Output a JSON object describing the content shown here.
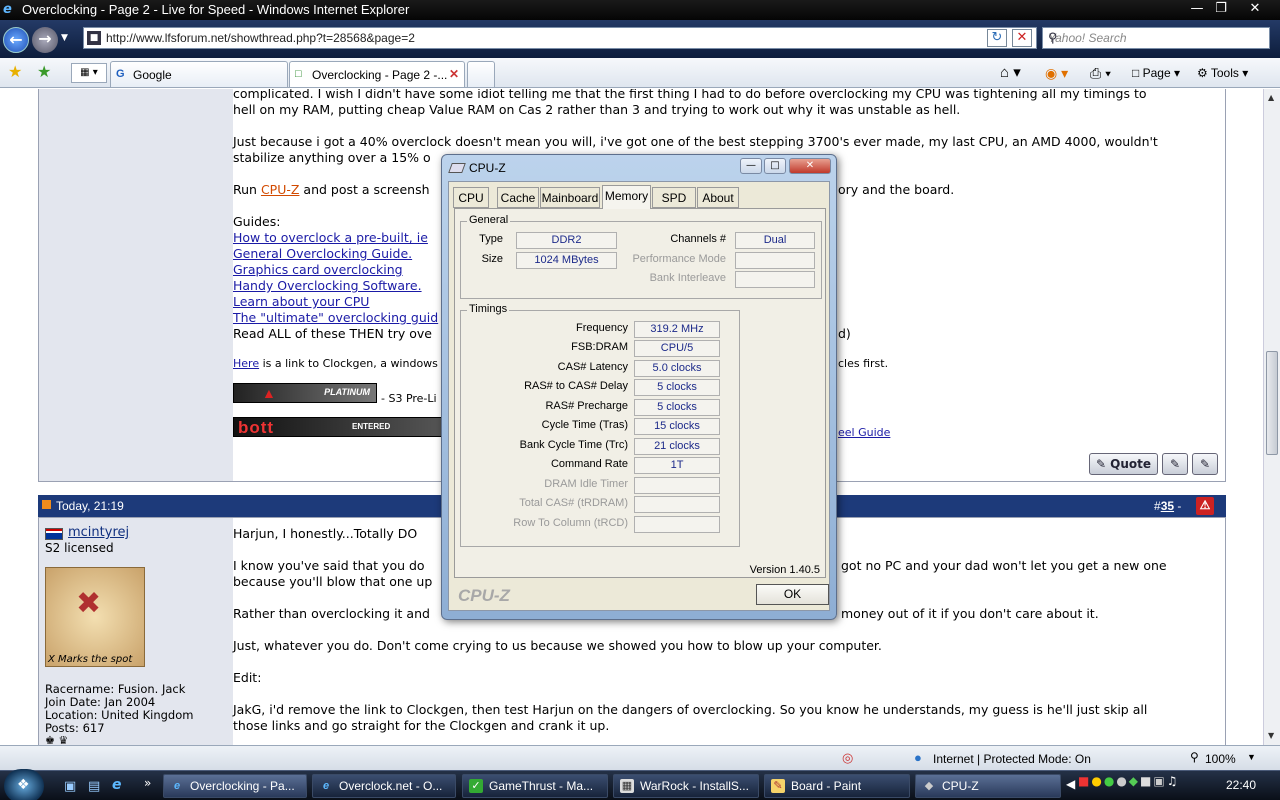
{
  "window": {
    "title": "Overclocking - Page 2 - Live for Speed - Windows Internet Explorer"
  },
  "toolbar": {
    "address": "http://www.lfsforum.net/showthread.php?t=28568&page=2",
    "search_placeholder": "Yahoo! Search"
  },
  "tabs": [
    {
      "label": "Google"
    },
    {
      "label": "Overclocking - Page 2 -..."
    }
  ],
  "commandbar": {
    "page": "Page",
    "tools": "Tools"
  },
  "post1": {
    "line1": "complicated. I wish I didn't have some idiot telling me that the first thing I had to do before overclocking my CPU was tightening all my timings to",
    "line2": "hell on my RAM, putting cheap Value RAM on Cas 2 rather than 3 and trying to work out why it was unstable as hell.",
    "line3": "Just because i got a 40% overclock doesn't mean you will, i've got one of the best stepping 3700's ever made, my last CPU, an AMD 4000, wouldn't",
    "line4a": "stabilize anything over a 15% o",
    "run_pre": "Run ",
    "run_link": "CPU-Z",
    "run_post": " and post a screensh",
    "run_tail": "ory and the board.",
    "guides": "Guides:",
    "links": [
      "How to overclock a pre-built, ie",
      "General Overclocking Guide.",
      "Graphics card overclocking",
      "Handy Overclocking Software.",
      "Learn about your CPU",
      "The \"ultimate\" overclocking guid"
    ],
    "readall": "Read ALL of these THEN try ove",
    "readall_tail": "d)",
    "here_link": "Here",
    "here_text": " is a link to Clockgen, a windows",
    "here_tail": "cles first.",
    "sig1": "- S3 Pre-Li",
    "sig_link_tail": "eel Guide",
    "quote_btn": "Quote"
  },
  "post2": {
    "date": "Today, 21:19",
    "number_prefix": "#",
    "number": "35",
    "number_sep": "-",
    "username": "mcintyrej",
    "license": "S2 licensed",
    "avatar_caption": "X Marks the spot",
    "racername": "Racername: Fusion. Jack",
    "joindate": "Join Date: Jan 2004",
    "location": "Location: United Kingdom",
    "posts": "Posts: 617",
    "l1": "Harjun, I honestly...Totally DO",
    "l2a": "I know you've said that you do",
    "l2b": "got no PC and your dad won't let you get a new one",
    "l3": "because you'll blow that one up",
    "l4a": "Rather than overclocking it and",
    "l4b": "money out of it if you don't care about it.",
    "l5": "Just, whatever you do. Don't come crying to us because we showed you how to blow up your computer.",
    "l6": "Edit:",
    "l7": "JakG, i'd remove the link to Clockgen, then test Harjun on the dangers of overclocking. So you know he understands, my guess is he'll just skip all",
    "l8": "those links and go straight for the Clockgen and crank it up."
  },
  "cpuz": {
    "title": "CPU-Z",
    "tabs": [
      "CPU",
      "Cache",
      "Mainboard",
      "Memory",
      "SPD",
      "About"
    ],
    "active_tab": "Memory",
    "general_label": "General",
    "type_label": "Type",
    "type_value": "DDR2",
    "size_label": "Size",
    "size_value": "1024 MBytes",
    "channels_label": "Channels #",
    "channels_value": "Dual",
    "perf_label": "Performance Mode",
    "bank_label": "Bank Interleave",
    "timings_label": "Timings",
    "timings": [
      {
        "label": "Frequency",
        "value": "319.2 MHz"
      },
      {
        "label": "FSB:DRAM",
        "value": "CPU/5"
      },
      {
        "label": "CAS# Latency",
        "value": "5.0 clocks"
      },
      {
        "label": "RAS# to CAS# Delay",
        "value": "5 clocks"
      },
      {
        "label": "RAS# Precharge",
        "value": "5 clocks"
      },
      {
        "label": "Cycle Time (Tras)",
        "value": "15 clocks"
      },
      {
        "label": "Bank Cycle Time (Trc)",
        "value": "21 clocks"
      },
      {
        "label": "Command Rate",
        "value": "1T"
      },
      {
        "label": "DRAM Idle Timer",
        "value": ""
      },
      {
        "label": "Total CAS# (tRDRAM)",
        "value": ""
      },
      {
        "label": "Row To Column (tRCD)",
        "value": ""
      }
    ],
    "version": "Version 1.40.5",
    "brand": "CPU-Z",
    "ok": "OK"
  },
  "status": {
    "zone": "Internet | Protected Mode: On",
    "zoom": "100%"
  },
  "taskbar": {
    "items": [
      "Overclocking - Pa...",
      "Overclock.net - O...",
      "GameThrust - Ma...",
      "WarRock - InstallS...",
      "Board - Paint",
      "CPU-Z"
    ],
    "clock": "22:40"
  }
}
